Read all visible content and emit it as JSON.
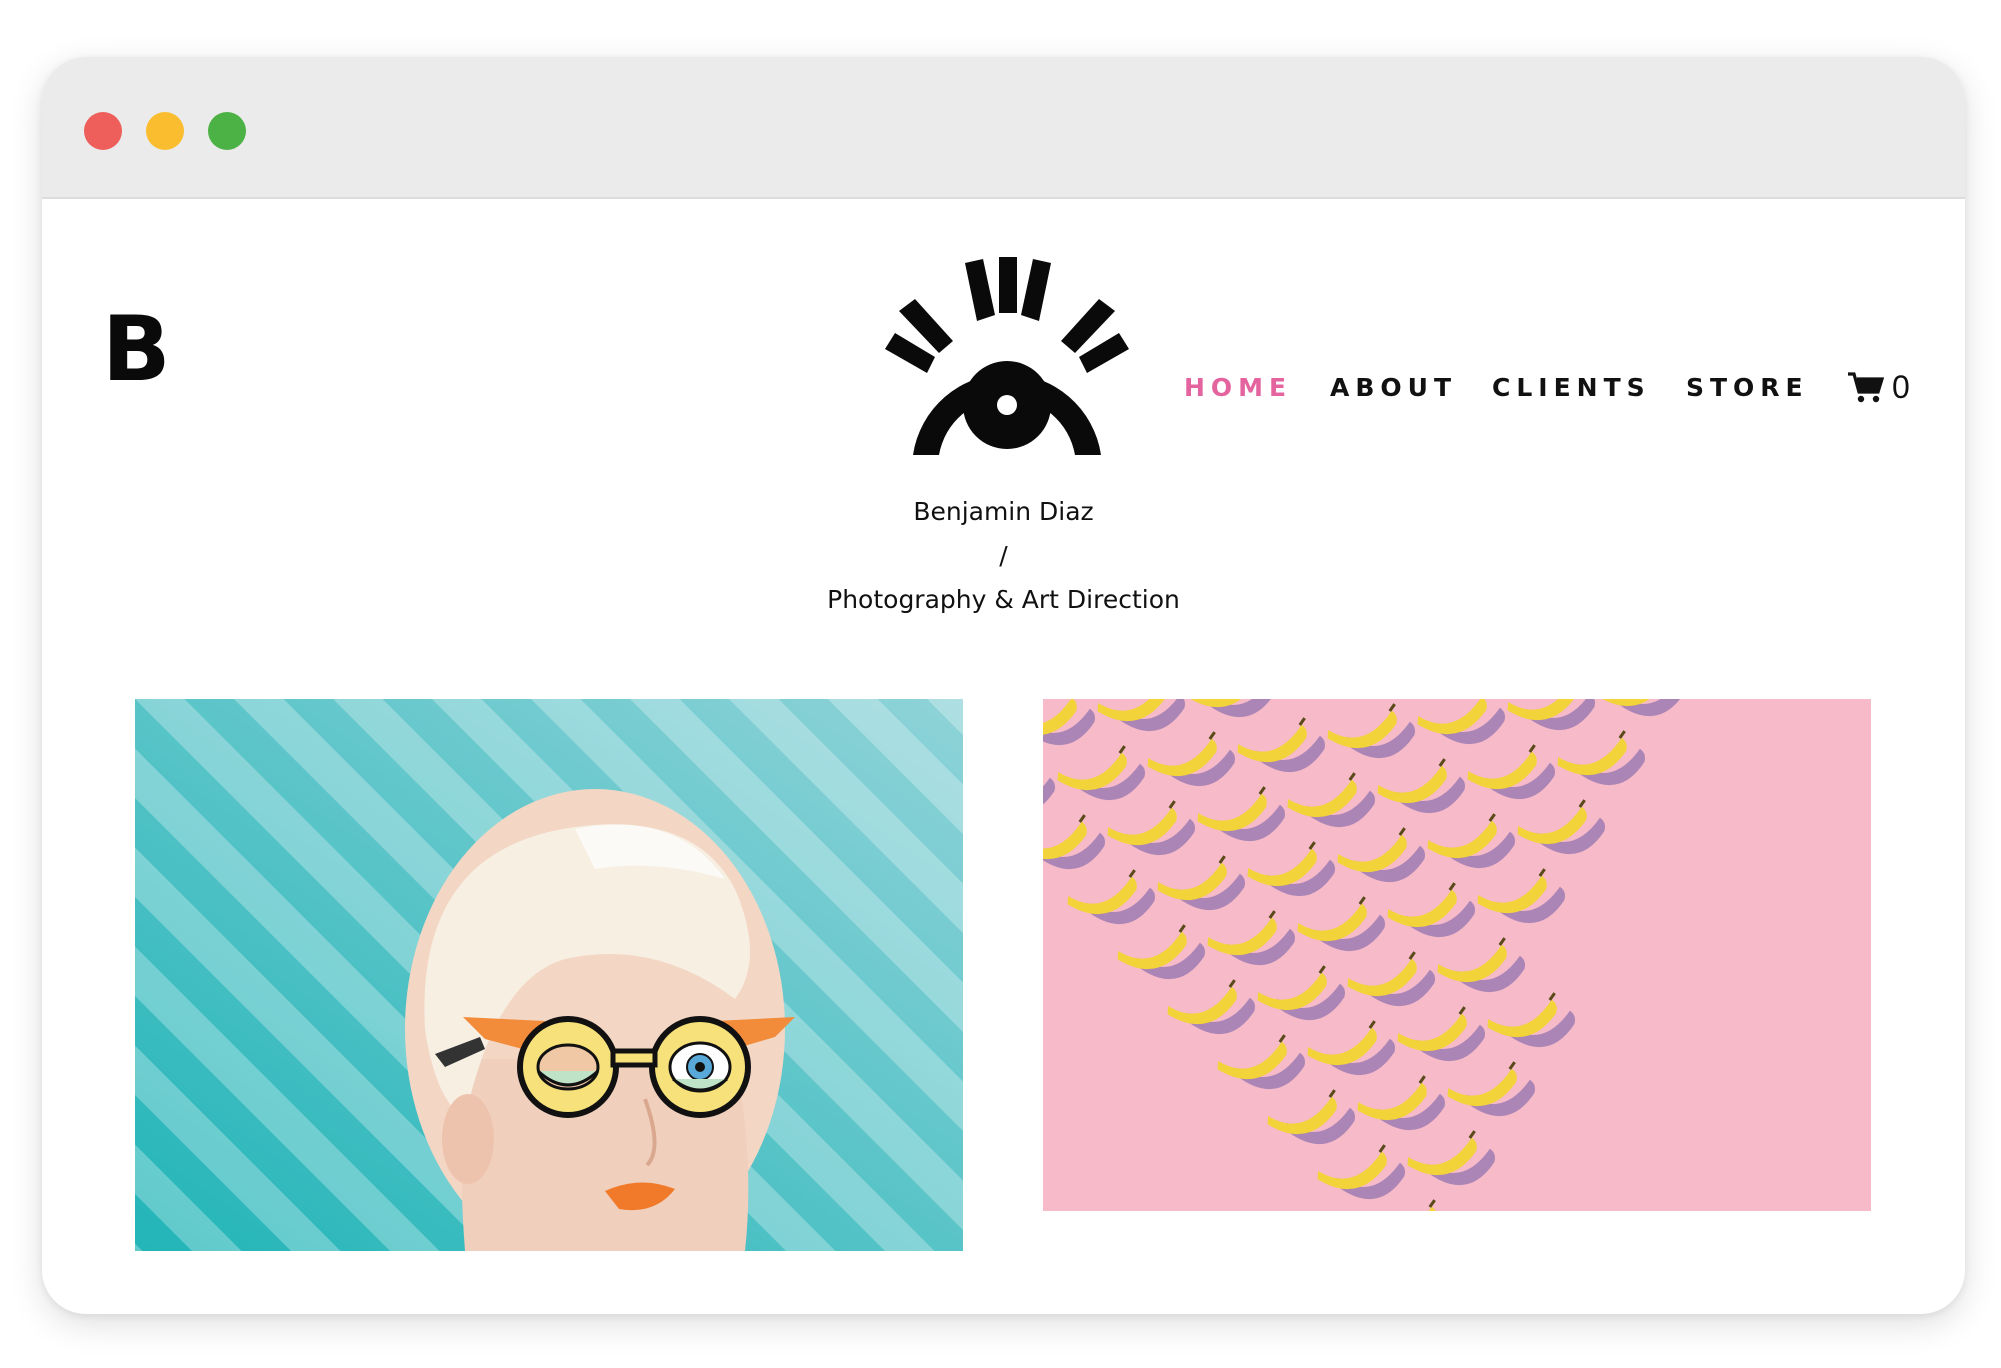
{
  "colors": {
    "nav_active": "#e4649f",
    "nav_default": "#111111",
    "traffic_red": "#ee5f5b",
    "traffic_yellow": "#fbbd30",
    "traffic_green": "#4db245",
    "photo1_bg": "#8fd3d8",
    "photo2_bg": "#f6bac8"
  },
  "site": {
    "monogram": "B"
  },
  "nav": {
    "items": [
      {
        "label": "HOME",
        "active": true
      },
      {
        "label": "ABOUT",
        "active": false
      },
      {
        "label": "CLIENTS",
        "active": false
      },
      {
        "label": "STORE",
        "active": false
      }
    ],
    "cart": {
      "icon": "cart-icon",
      "count": "0"
    }
  },
  "hero": {
    "name": "Benjamin Diaz",
    "separator": "/",
    "tagline": "Photography & Art Direction"
  },
  "gallery": {
    "items": [
      {
        "subject": "woman with illustrated glasses on striped teal background"
      },
      {
        "subject": "bananas pattern on pink background"
      }
    ]
  }
}
